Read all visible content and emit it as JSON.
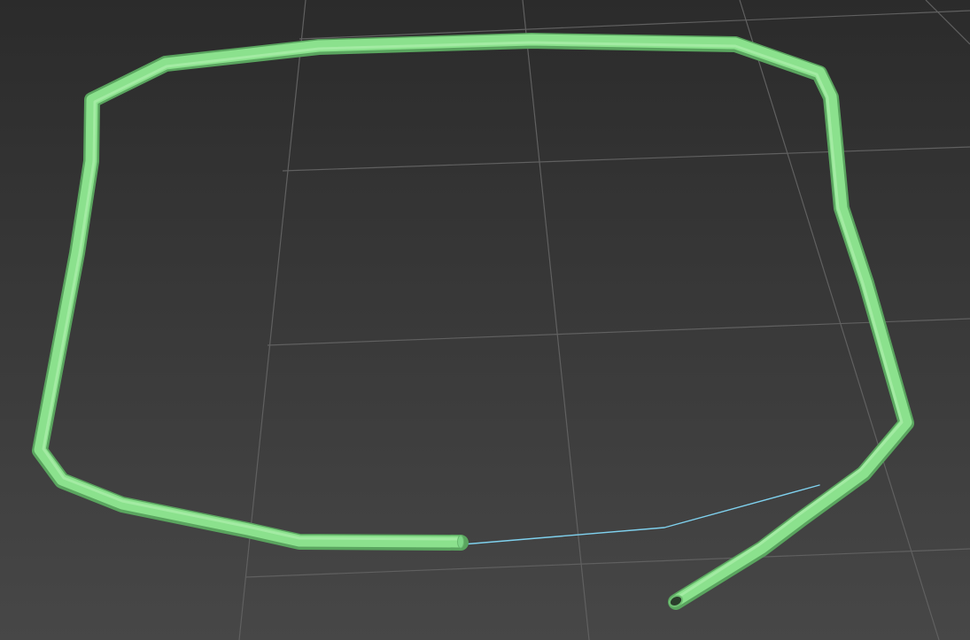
{
  "viewport": {
    "background_top": "#2d2d2d",
    "background_bottom": "#454545",
    "grid_color": "#5c5c5c"
  },
  "spline_tube": {
    "type": "closed-loop-tube-with-gap",
    "tube_color": "#88e08a",
    "tube_highlight": "#b7f4b6",
    "tube_shadow": "#58a85c",
    "gap_segment_color": "#79c9e8"
  }
}
